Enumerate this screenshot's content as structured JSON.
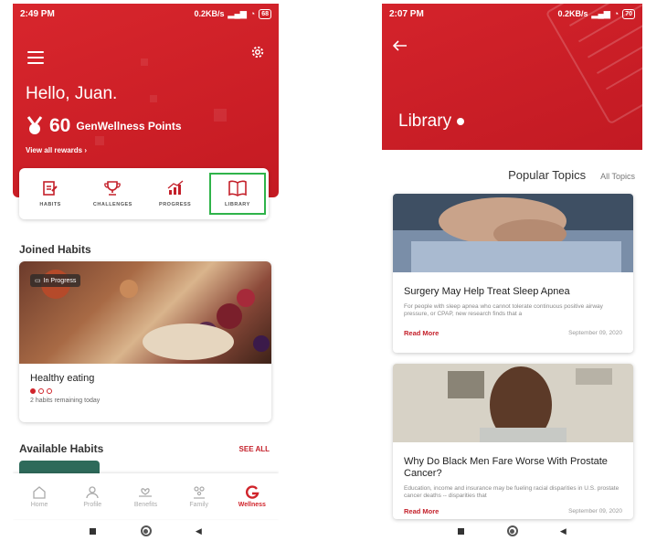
{
  "left": {
    "status": {
      "time": "2:49 PM",
      "net": "0.2KB/s",
      "battery": "68"
    },
    "greeting": "Hello, Juan.",
    "points": {
      "value": "60",
      "label": "GenWellness Points"
    },
    "view_rewards": "View all rewards",
    "nav": [
      {
        "label": "HABITS",
        "icon": "habits-icon"
      },
      {
        "label": "CHALLENGES",
        "icon": "trophy-icon"
      },
      {
        "label": "PROGRESS",
        "icon": "progress-chart-icon"
      },
      {
        "label": "LIBRARY",
        "icon": "book-icon"
      }
    ],
    "joined_title": "Joined Habits",
    "habit": {
      "badge": "In Progress",
      "name": "Healthy eating",
      "progress_dots_filled": 1,
      "progress_dots_total": 3,
      "sub": "2 habits remaining today"
    },
    "available_title": "Available Habits",
    "see_all": "SEE ALL",
    "tabs": [
      {
        "label": "Home",
        "icon": "home-icon"
      },
      {
        "label": "Profile",
        "icon": "profile-icon"
      },
      {
        "label": "Benefits",
        "icon": "benefits-icon"
      },
      {
        "label": "Family",
        "icon": "family-icon"
      },
      {
        "label": "Wellness",
        "icon": "wellness-icon"
      }
    ],
    "accent": "#d0242b",
    "highlight": "#2fb34a"
  },
  "right": {
    "status": {
      "time": "2:07 PM",
      "net": "0.2KB/s",
      "battery": "70"
    },
    "title": "Library",
    "popular": "Popular Topics",
    "all_topics": "All Topics",
    "articles": [
      {
        "title": "Surgery May Help Treat Sleep Apnea",
        "excerpt": "For people with sleep apnea who cannot tolerate continuous positive airway pressure, or CPAP, new research finds that a",
        "read_more": "Read More",
        "date": "September 09, 2020"
      },
      {
        "title": "Why Do Black Men Fare Worse With Prostate Cancer?",
        "excerpt": "Education, income and insurance may be fueling racial disparities in U.S. prostate cancer deaths -- disparities that",
        "read_more": "Read More",
        "date": "September 09, 2020"
      }
    ]
  }
}
